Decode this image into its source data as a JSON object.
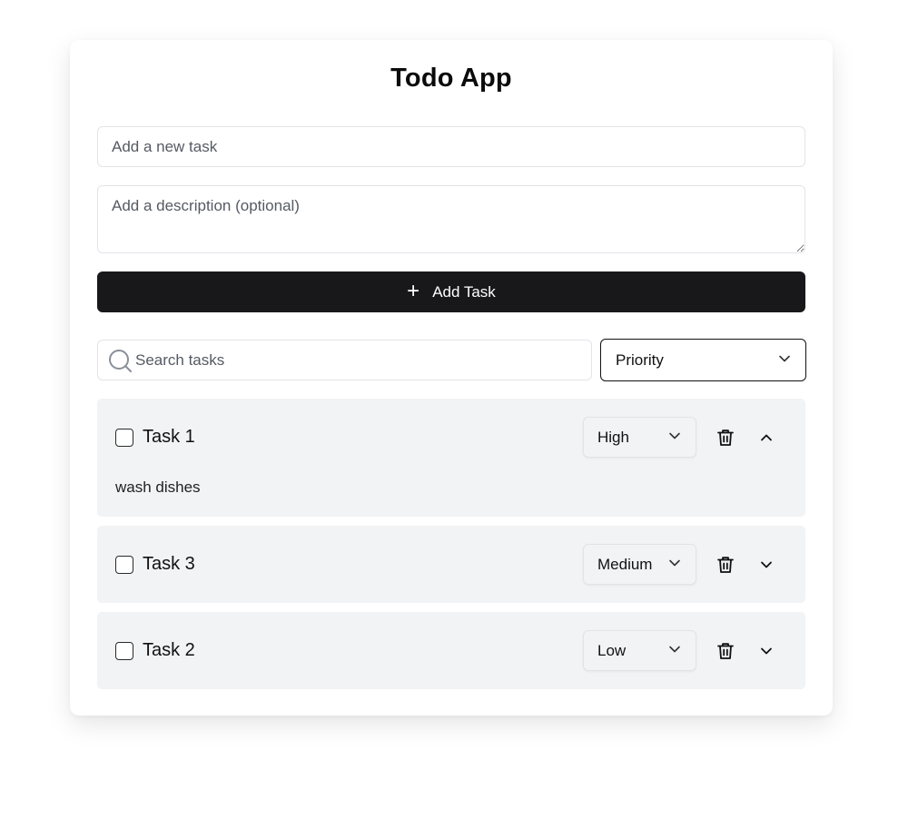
{
  "app": {
    "title": "Todo App"
  },
  "form": {
    "task_placeholder": "Add a new task",
    "description_placeholder": "Add a description (optional)",
    "add_button_label": "Add Task",
    "add_button_icon": "plus-icon"
  },
  "filters": {
    "search_placeholder": "Search tasks",
    "search_icon": "search-icon",
    "priority_selected": "Priority"
  },
  "tasks": [
    {
      "title": "Task 1",
      "completed": false,
      "priority": "High",
      "expanded": true,
      "description": "wash dishes"
    },
    {
      "title": "Task 3",
      "completed": false,
      "priority": "Medium",
      "expanded": false
    },
    {
      "title": "Task 2",
      "completed": false,
      "priority": "Low",
      "expanded": false
    }
  ],
  "colors": {
    "primary_button": "#18181a",
    "task_background": "#f2f3f5",
    "border": "#e2e4e8"
  }
}
